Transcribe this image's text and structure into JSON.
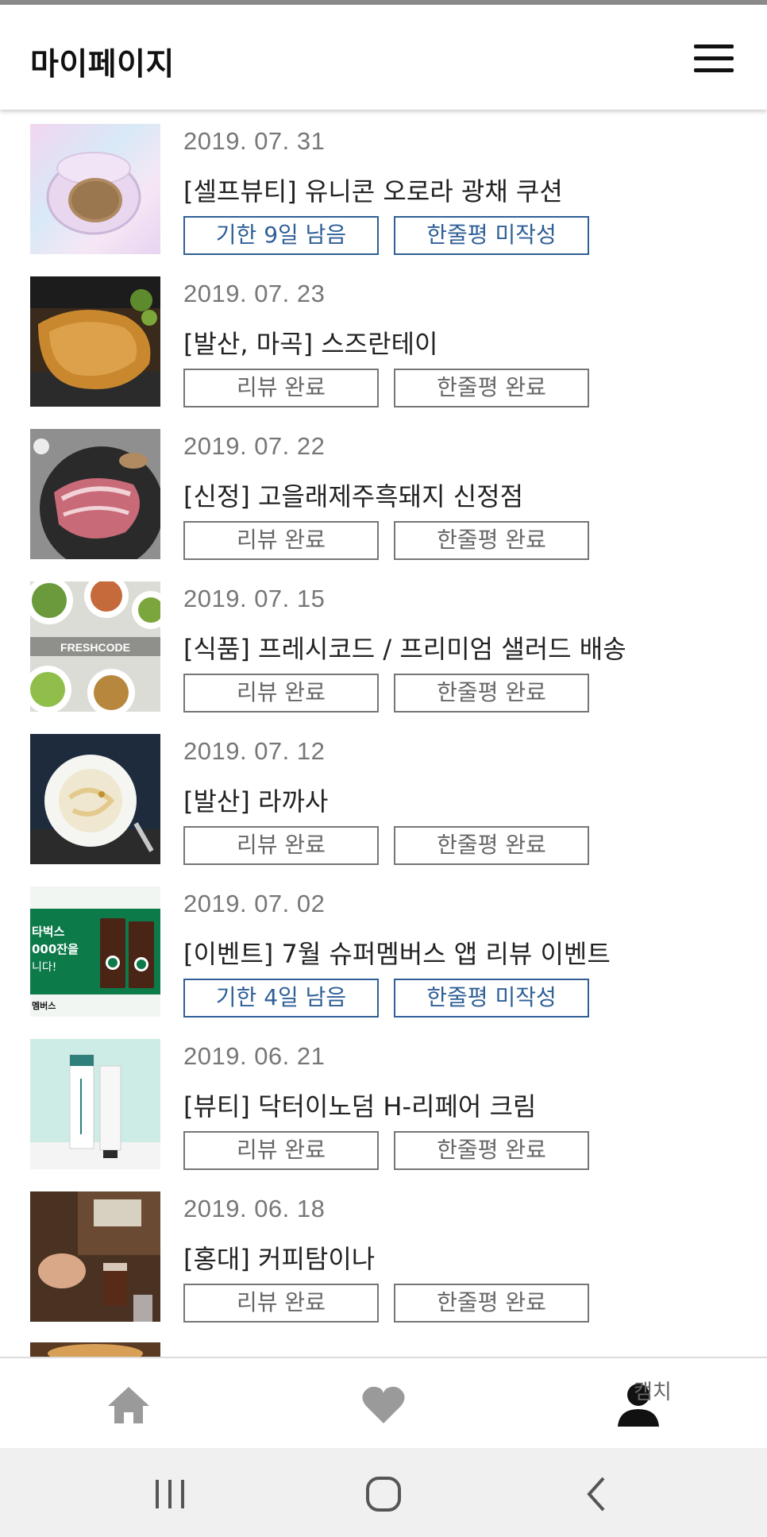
{
  "header": {
    "title": "마이페이지",
    "menu_icon": "hamburger-menu-icon"
  },
  "items": [
    {
      "date": "2019. 07. 31",
      "title": "[셀프뷰티] 유니콘 오로라 광채 쿠션",
      "btn1": "기한 9일 남음",
      "btn2": "한줄평 미작성",
      "pending": true,
      "thumb": "cushion-compact-image"
    },
    {
      "date": "2019. 07. 23",
      "title": "[발산, 마곡] 스즈란테이",
      "btn1": "리뷰 완료",
      "btn2": "한줄평 완료",
      "pending": false,
      "thumb": "tonkatsu-image"
    },
    {
      "date": "2019. 07. 22",
      "title": "[신정] 고을래제주흑돼지 신정점",
      "btn1": "리뷰 완료",
      "btn2": "한줄평 완료",
      "pending": false,
      "thumb": "pork-belly-image"
    },
    {
      "date": "2019. 07. 15",
      "title": "[식품] 프레시코드 / 프리미엄 샐러드 배송",
      "btn1": "리뷰 완료",
      "btn2": "한줄평 완료",
      "pending": false,
      "thumb": "salad-image",
      "thumb_text": "FRESHCODE"
    },
    {
      "date": "2019. 07. 12",
      "title": "[발산] 라까사",
      "btn1": "리뷰 완료",
      "btn2": "한줄평 완료",
      "pending": false,
      "thumb": "pasta-image"
    },
    {
      "date": "2019. 07. 02",
      "title": "[이벤트] 7월 슈퍼멤버스 앱 리뷰 이벤트",
      "btn1": "기한 4일 남음",
      "btn2": "한줄평 미작성",
      "pending": true,
      "thumb": "starbucks-event-image",
      "thumb_lines": [
        "타벅스",
        "000잔을",
        "니다!",
        "멤버스"
      ]
    },
    {
      "date": "2019. 06. 21",
      "title": "[뷰티] 닥터이노덤 H-리페어 크림",
      "btn1": "리뷰 완료",
      "btn2": "한줄평 완료",
      "pending": false,
      "thumb": "cream-tube-image"
    },
    {
      "date": "2019. 06. 18",
      "title": "[홍대] 커피탐이나",
      "btn1": "리뷰 완료",
      "btn2": "한줄평 완료",
      "pending": false,
      "thumb": "coffee-barista-image"
    }
  ],
  "tabbar": {
    "label": "캠치",
    "tabs": [
      "home-icon",
      "heart-icon",
      "profile-icon"
    ]
  },
  "colors": {
    "pending": "#2f5f96",
    "done": "#767676",
    "header_bg": "#ffffff",
    "nav_bg": "#f0f0f0"
  }
}
